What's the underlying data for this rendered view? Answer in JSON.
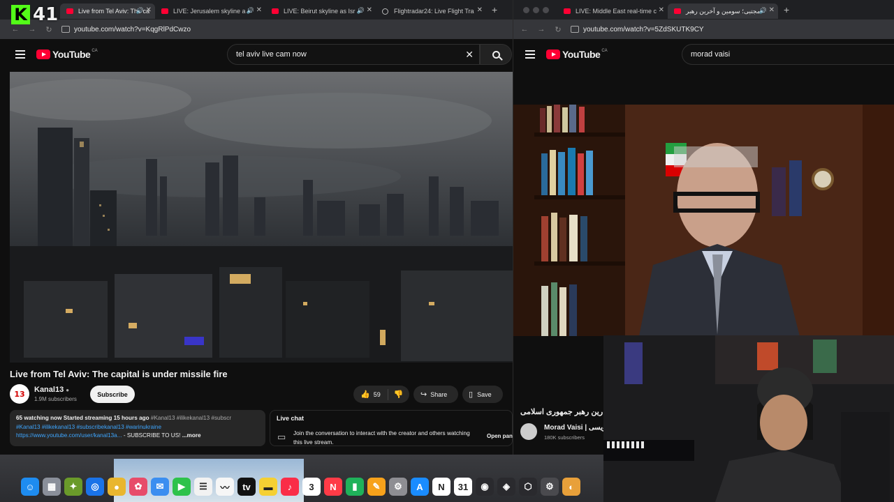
{
  "overlay": {
    "badge_letter": "K",
    "badge_number": "41"
  },
  "left_window": {
    "tabs": [
      {
        "title": "Live from Tel Aviv: The ca",
        "type": "youtube",
        "active": true
      },
      {
        "title": "LIVE: Jerusalem skyline a",
        "type": "youtube",
        "active": false
      },
      {
        "title": "LIVE: Beirut skyline as Isr",
        "type": "youtube",
        "active": false
      },
      {
        "title": "Flightradar24: Live Flight Tra",
        "type": "flightradar",
        "active": false
      }
    ],
    "url": "youtube.com/watch?v=KqgRlPdCwzo",
    "youtube": {
      "logo": "YouTube",
      "country": "CA",
      "search_value": "tel aviv live cam now"
    },
    "video": {
      "title": "Live from Tel Aviv: The capital is under missile fire",
      "channel": {
        "name": "Kanal13",
        "subscribers": "1.9M subscribers",
        "avatar_text": "13"
      },
      "subscribe_label": "Subscribe",
      "likes": "59",
      "share_label": "Share",
      "save_label": "Save",
      "description": {
        "stats": "65 watching now  Started streaming 15 hours ago",
        "tags_line1_inline": "#Kanal13 #ilikekanal13 #subscr",
        "tags_line2": "#Kanal13 #ilikekanal13 #subscribekanal13 #warinukraine",
        "link": "https://www.youtube.com/user/kanal13a...",
        "link_suffix": " - SUBSCRIBE TO US!",
        "more": "...more"
      },
      "live_chat": {
        "title": "Live chat",
        "message": "Join the conversation to interact with the creator and others watching this live stream.",
        "open_label": "Open pan"
      }
    }
  },
  "right_window": {
    "tabs": [
      {
        "title": "LIVE: Middle East real-time c",
        "type": "youtube",
        "active": false
      },
      {
        "title": "مجتبی؛ سومین و آخرین رهبر",
        "type": "youtube",
        "active": true
      }
    ],
    "url": "youtube.com/watch?v=5ZdSKUTK9CY",
    "youtube": {
      "logo": "YouTube",
      "country": "CA",
      "search_value": "morad vaisi"
    },
    "video": {
      "title": "رین رهبر جمهوری اسلامی",
      "channel": {
        "name": "Morad Vaisi | ویسی",
        "subscribers": "180K subscribers"
      }
    }
  },
  "dock": {
    "apps": [
      {
        "name": "finder",
        "glyph": "☺",
        "color": "#1e8cf0"
      },
      {
        "name": "launchpad",
        "glyph": "▦",
        "color": "#8a8f9a"
      },
      {
        "name": "maps-tool",
        "glyph": "✦",
        "color": "#6a9a2a"
      },
      {
        "name": "safari",
        "glyph": "◎",
        "color": "#1a73e8"
      },
      {
        "name": "chrome",
        "glyph": "●",
        "color": "#e9b62e"
      },
      {
        "name": "photos",
        "glyph": "✿",
        "color": "#e74c6a"
      },
      {
        "name": "mail",
        "glyph": "✉",
        "color": "#3b8ef0"
      },
      {
        "name": "facetime",
        "glyph": "▶",
        "color": "#2ec24b"
      },
      {
        "name": "reminders",
        "glyph": "☰",
        "color": "#f2f2f2"
      },
      {
        "name": "freeform",
        "glyph": "〰",
        "color": "#f6f6f6"
      },
      {
        "name": "apple-tv",
        "glyph": "tv",
        "color": "#111111"
      },
      {
        "name": "notes",
        "glyph": "▬",
        "color": "#f5d033"
      },
      {
        "name": "music",
        "glyph": "♪",
        "color": "#fa2d48"
      },
      {
        "name": "calendar",
        "glyph": "3",
        "color": "#ffffff"
      },
      {
        "name": "news",
        "glyph": "N",
        "color": "#ff3b47"
      },
      {
        "name": "numbers",
        "glyph": "▮",
        "color": "#1fb25a"
      },
      {
        "name": "pages",
        "glyph": "✎",
        "color": "#f7a21b"
      },
      {
        "name": "system-settings",
        "glyph": "⚙",
        "color": "#8e8e93"
      },
      {
        "name": "app-store",
        "glyph": "A",
        "color": "#1a8cff"
      },
      {
        "name": "notion",
        "glyph": "N",
        "color": "#ffffff"
      },
      {
        "name": "calendar-31",
        "glyph": "31",
        "color": "#ffffff"
      },
      {
        "name": "utility-a",
        "glyph": "◉",
        "color": "#2a2a2e"
      },
      {
        "name": "utility-b",
        "glyph": "◈",
        "color": "#2a2a2e"
      },
      {
        "name": "unity",
        "glyph": "⬡",
        "color": "#2a2a2e"
      },
      {
        "name": "utility-c",
        "glyph": "⚙",
        "color": "#4a4a4e"
      },
      {
        "name": "logic",
        "glyph": "◐",
        "color": "#e8a03a"
      }
    ],
    "calendar_month": "MAR",
    "reminders_badge": "6"
  }
}
